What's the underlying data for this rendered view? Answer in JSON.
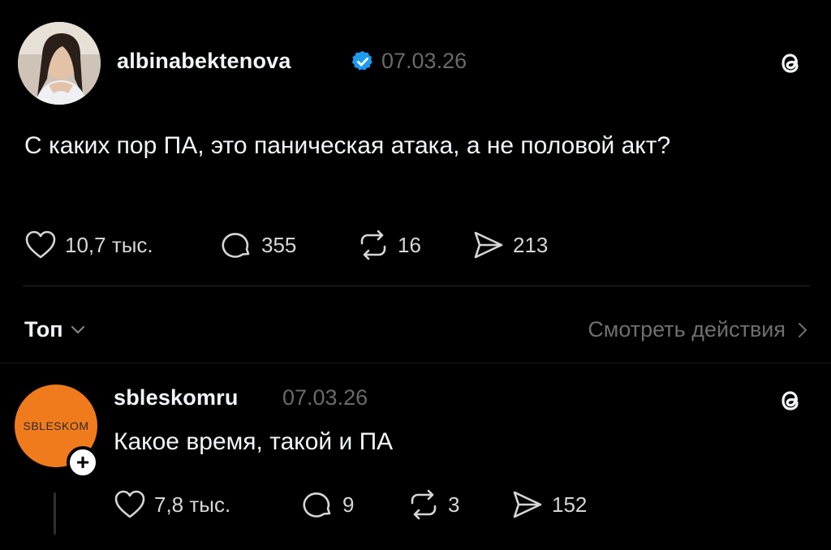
{
  "post": {
    "username": "albinabektenova",
    "date": "07.03.26",
    "text": "С каких пор ПА, это паническая атака, а не половой акт?",
    "likes": "10,7 тыс.",
    "comments": "355",
    "reposts": "16",
    "shares": "213"
  },
  "sort": {
    "label": "Топ"
  },
  "activity": {
    "label": "Смотреть действия"
  },
  "reply": {
    "username": "sbleskomru",
    "date": "07.03.26",
    "avatar_text": "SBLESKOM",
    "text": "Какое время, такой и ПА",
    "likes": "7,8 тыс.",
    "comments": "9",
    "reposts": "3",
    "shares": "152"
  },
  "colors": {
    "verified": "#1d9bf0",
    "avatar_orange": "#f07b1d"
  }
}
